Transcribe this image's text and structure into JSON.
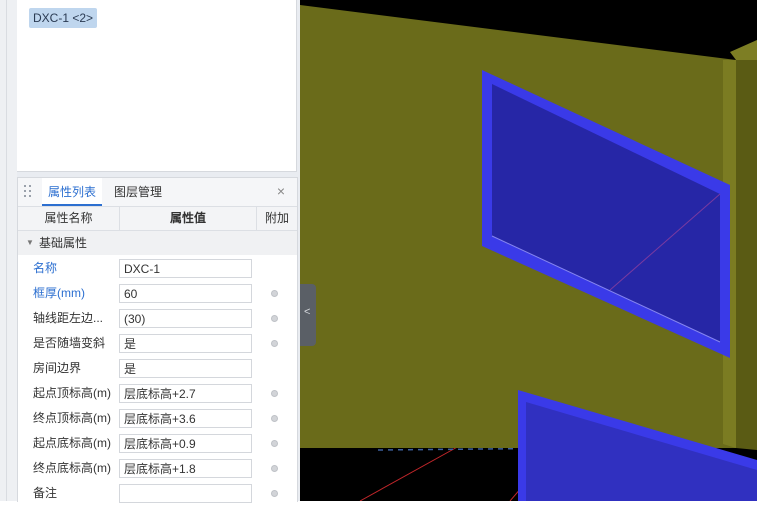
{
  "component_list": {
    "selected_item": "DXC-1 <2>"
  },
  "panel": {
    "tabs": [
      "属性列表",
      "图层管理"
    ],
    "close_glyph": "×",
    "columns": {
      "name": "属性名称",
      "value": "属性值",
      "extra": "附加"
    },
    "group": "基础属性",
    "rows": [
      {
        "name": "名称",
        "value": "DXC-1",
        "blue": true,
        "has_dot": false
      },
      {
        "name": "框厚(mm)",
        "value": "60",
        "blue": true,
        "has_dot": true
      },
      {
        "name": "轴线距左边...",
        "value": "(30)",
        "blue": false,
        "has_dot": true
      },
      {
        "name": "是否随墙变斜",
        "value": "是",
        "blue": false,
        "has_dot": true
      },
      {
        "name": "房间边界",
        "value": "是",
        "blue": false,
        "has_dot": false
      },
      {
        "name": "起点顶标高(m)",
        "value": "层底标高+2.7",
        "blue": false,
        "has_dot": true
      },
      {
        "name": "终点顶标高(m)",
        "value": "层底标高+3.6",
        "blue": false,
        "has_dot": true
      },
      {
        "name": "起点底标高(m)",
        "value": "层底标高+0.9",
        "blue": false,
        "has_dot": true
      },
      {
        "name": "终点底标高(m)",
        "value": "层底标高+1.8",
        "blue": false,
        "has_dot": true
      },
      {
        "name": "备注",
        "value": "",
        "blue": false,
        "has_dot": true
      }
    ]
  },
  "icons": {
    "drag": "drag-handle-icon",
    "collapse": "chevron-left-icon",
    "group_toggle": "triangle-down-icon"
  },
  "colors": {
    "wall": "#6a6b1a",
    "window_frame": "#3a3ae8",
    "window_glass": "#2626a6",
    "selection_blue": "#2c6fd0"
  }
}
